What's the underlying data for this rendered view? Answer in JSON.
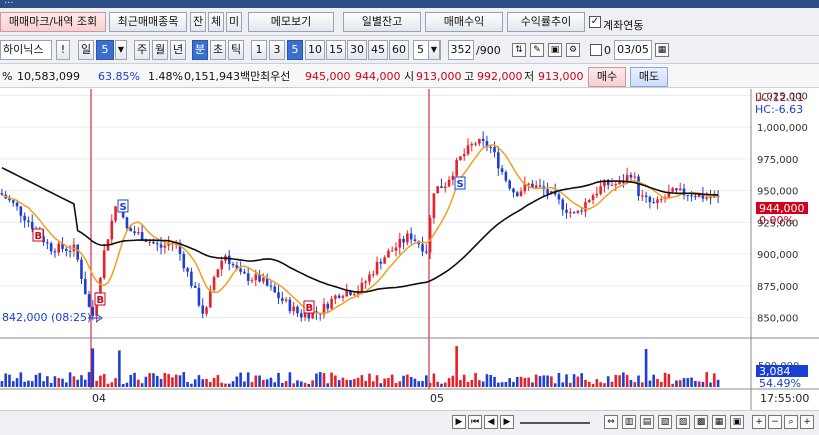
{
  "title_bar": "...",
  "row1": {
    "tab_main": "매매마크/내역 조회",
    "tab_recent": "최근매매종목",
    "tab_balance_short": "잔",
    "tab_trade_short": "체",
    "tab_unsettled_short": "미",
    "memo": "메모보기",
    "daily_balance": "일별잔고",
    "trade_profit": "매매수익",
    "return_trend": "수익률추이",
    "account_link": "계좌연동",
    "account_link_checked": true
  },
  "row2": {
    "stock_name": "하이닉스",
    "exclaim": "!",
    "period_day": "일",
    "period_value": "5",
    "period_week": "주",
    "period_month": "월",
    "period_year": "년",
    "period_minute": "분",
    "period_second": "초",
    "period_tick": "틱",
    "intervals": [
      "1",
      "3",
      "5",
      "10",
      "15",
      "30",
      "45",
      "60"
    ],
    "interval_selected": "5",
    "count_select": "5",
    "range_value": "352",
    "range_total": "/900",
    "zero_label": "0",
    "date_value": "03/05"
  },
  "row3": {
    "pct_prefix": "%",
    "volume": "10,583,099",
    "ratio": "63.85%",
    "change_rate": "1.48%",
    "amount": "0,151,943백만",
    "best_label": "최우선",
    "best_ask": "945,000",
    "best_bid": "944,000",
    "open_label": "시",
    "open": "913,000",
    "high_label": "고",
    "high": "992,000",
    "low_label": "저",
    "low": "913,000",
    "buy": "매수",
    "sell": "매도"
  },
  "chart_data": {
    "type": "candlestick",
    "y_ticks": [
      "1,025,000",
      "1,000,000",
      "975,000",
      "950,000",
      "925,000",
      "900,000",
      "875,000",
      "850,000"
    ],
    "ylim": [
      837000,
      1030000
    ],
    "current_price": "944,000",
    "current_pct": "0.00%",
    "lc_label": "LC:12.11",
    "hc_label": "HC:-6.63",
    "low_annotation": "842,000 (08:25)",
    "date_labels": [
      "04",
      "05"
    ],
    "time_label": "17:55:00",
    "volume_tick": "500,000",
    "volume_current": "3,084",
    "volume_pct": "54.49%",
    "markers": [
      {
        "label": "B"
      },
      {
        "label": "B"
      },
      {
        "label": "S"
      },
      {
        "label": "B"
      },
      {
        "label": "S"
      }
    ]
  }
}
